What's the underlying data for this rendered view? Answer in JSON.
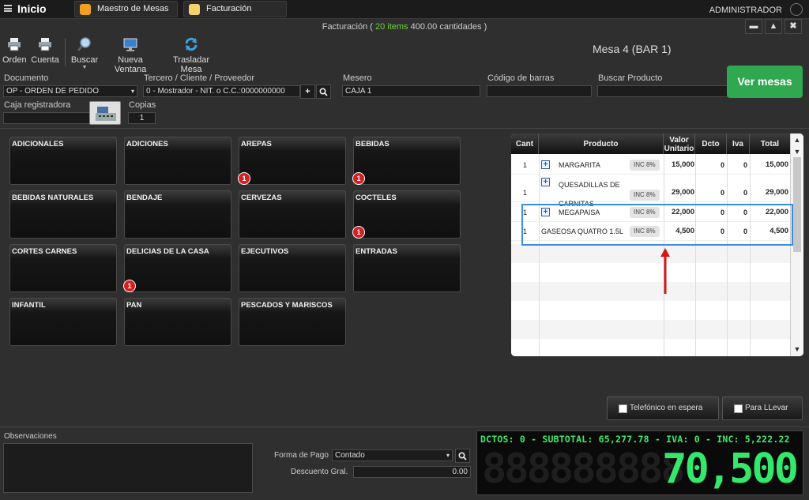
{
  "topbar": {
    "title": "Inicio",
    "tabs": [
      {
        "label": "Maestro de Mesas",
        "icon": "tables-icon",
        "color": "#f0a020"
      },
      {
        "label": "Facturación",
        "icon": "invoice-icon",
        "color": "#f6d36a"
      }
    ],
    "user": "ADMINISTRADOR"
  },
  "status": {
    "prefix": "Facturación (",
    "items": "20 items",
    "rest": "400.00 cantidades )"
  },
  "window_buttons": [
    "▬",
    "▲",
    "✖"
  ],
  "toolbar": {
    "orden": "Orden",
    "cuenta": "Cuenta",
    "buscar": "Buscar",
    "nueva_ventana": "Nueva Ventana",
    "trasladar_mesa": "Trasladar Mesa"
  },
  "mesa_title": "Mesa 4 (BAR 1)",
  "form": {
    "documento_label": "Documento",
    "documento_value": "OP - ORDEN DE PEDIDO",
    "tercero_label": "Tercero / Cliente / Proveedor",
    "tercero_value": "0 - Mostrador - NIT. o C.C.:0000000000",
    "mesero_label": "Mesero",
    "mesero_value": "CAJA 1",
    "codigo_label": "Código de barras",
    "codigo_value": "",
    "buscar_producto_label": "Buscar Producto",
    "buscar_producto_value": "",
    "caja_label": "Caja registradora",
    "copias_label": "Copias",
    "copias_value": "1",
    "ver_mesas": "Ver mesas"
  },
  "categories": [
    {
      "name": "ADICIONALES",
      "badge": ""
    },
    {
      "name": "ADICIONES",
      "badge": ""
    },
    {
      "name": "AREPAS",
      "badge": "1"
    },
    {
      "name": "BEBIDAS",
      "badge": "1"
    },
    {
      "name": "BEBIDAS NATURALES",
      "badge": ""
    },
    {
      "name": "BENDAJE",
      "badge": ""
    },
    {
      "name": "CERVEZAS",
      "badge": ""
    },
    {
      "name": "COCTELES",
      "badge": "1"
    },
    {
      "name": "CORTES CARNES",
      "badge": ""
    },
    {
      "name": "DELICIAS DE LA CASA",
      "badge": "1"
    },
    {
      "name": "EJECUTIVOS",
      "badge": ""
    },
    {
      "name": "ENTRADAS",
      "badge": ""
    },
    {
      "name": "INFANTIL",
      "badge": ""
    },
    {
      "name": "PAN",
      "badge": ""
    },
    {
      "name": "PESCADOS Y MARISCOS",
      "badge": ""
    }
  ],
  "order": {
    "headers": {
      "cant": "Cant",
      "producto": "Producto",
      "valor": "Valor Unitario",
      "dcto": "Dcto",
      "iva": "Iva",
      "total": "Total"
    },
    "rows": [
      {
        "cant": "1",
        "producto": "MARGARITA",
        "tax": "INC 8%",
        "valor": "15,000",
        "dcto": "0",
        "iva": "0",
        "total": "15,000",
        "plus": true
      },
      {
        "cant": "1",
        "producto": "QUESADILLAS DE CARNITAS",
        "tax": "INC 8%",
        "valor": "29,000",
        "dcto": "0",
        "iva": "0",
        "total": "29,000",
        "plus": true
      },
      {
        "cant": "1",
        "producto": "MEGAPAISA",
        "tax": "INC 8%",
        "valor": "22,000",
        "dcto": "0",
        "iva": "0",
        "total": "22,000",
        "plus": true
      },
      {
        "cant": "1",
        "producto": "GASEOSA QUATRO 1.5L",
        "tax": "INC 8%",
        "valor": "4,500",
        "dcto": "0",
        "iva": "0",
        "total": "4,500",
        "plus": false
      }
    ]
  },
  "options": {
    "telefonico": "Telefónico en espera",
    "llevar": "Para LLevar"
  },
  "bottom": {
    "observaciones_label": "Observaciones",
    "forma_pago_label": "Forma de Pago",
    "forma_pago_value": "Contado",
    "descuento_label": "Descuento Gral.",
    "descuento_value": "0.00"
  },
  "lcd": {
    "summary": "DCTOS: 0 - SUBTOTAL: 65,277.78 - IVA: 0 - INC: 5,222.22",
    "total": "70,500"
  },
  "colors": {
    "accent_green": "#2fa84f",
    "lcd_green": "#33e86a",
    "badge_red": "#d42020",
    "highlight_blue": "#3b8de0",
    "arrow_red": "#d01818"
  }
}
